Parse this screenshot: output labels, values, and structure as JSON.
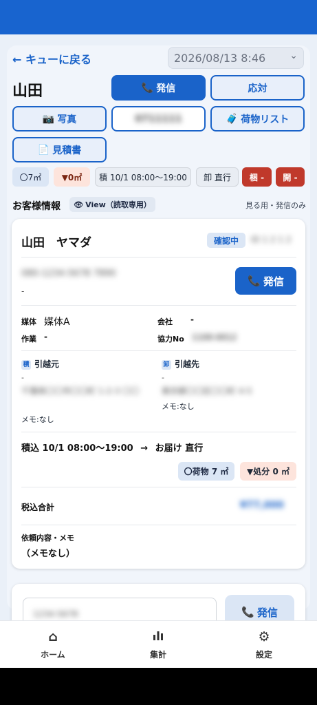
{
  "header": {
    "back_label": "← キューに戻る",
    "datetime": "2026/08/13 8:46"
  },
  "customer_name": "山田",
  "actions": {
    "call": "発信",
    "respond": "応対",
    "photo": "写真",
    "phone_field": "0711111",
    "luggage_list": "荷物リスト",
    "estimate": "見積書"
  },
  "chips": {
    "volume": "〇7㎡",
    "disposal": "▼0㎡",
    "loading": "積 10/1 08:00〜19:00",
    "unloading": "卸 直行",
    "pack": "梱 -",
    "unpack": "開 -"
  },
  "section": {
    "title": "お客様情報",
    "view_chip": "View（読取専用）",
    "view_only": "見る用・発信のみ"
  },
  "card": {
    "name": "山田　ヤマダ",
    "status": "確認中",
    "status_extra": "ID 1 2 1 2",
    "phone": "080-1234-5678 7890",
    "phone_sub": "-",
    "call_button": "発信",
    "media_label": "媒体",
    "media_value": "媒体A",
    "company_label": "会社",
    "company_value": "-",
    "work_label": "作業",
    "work_value": "-",
    "partner_label": "協力No",
    "partner_value": "1100-0012",
    "from_tag": "積",
    "from_label": "引越元",
    "from_dash": "-",
    "from_address": "千葉県〇〇市〇〇町 1-2-3 〇〇",
    "from_memo": "メモ:なし",
    "to_tag": "卸",
    "to_label": "引越先",
    "to_dash": "-",
    "to_address": "東京都〇〇区〇〇町 4-5",
    "to_memo": "メモ:なし",
    "schedule": "積込 10/1 08:00〜19:00",
    "arrow": "→",
    "delivery": "お届け 直行",
    "luggage_chip": "〇荷物 7 ㎡",
    "disposal_chip": "▼処分 0 ㎡",
    "total_label": "税込合計",
    "total_value": "¥77,000",
    "request_label": "依頼内容・メモ",
    "request_value": "（メモなし）"
  },
  "card2": {
    "field": "1234-5678",
    "call_button": "発信"
  },
  "nav": {
    "home": "ホーム",
    "stats": "集計",
    "settings": "設定"
  },
  "colors": {
    "primary": "#1a63c9",
    "danger": "#c0392b",
    "disposal_bg": "#fde4dc"
  }
}
